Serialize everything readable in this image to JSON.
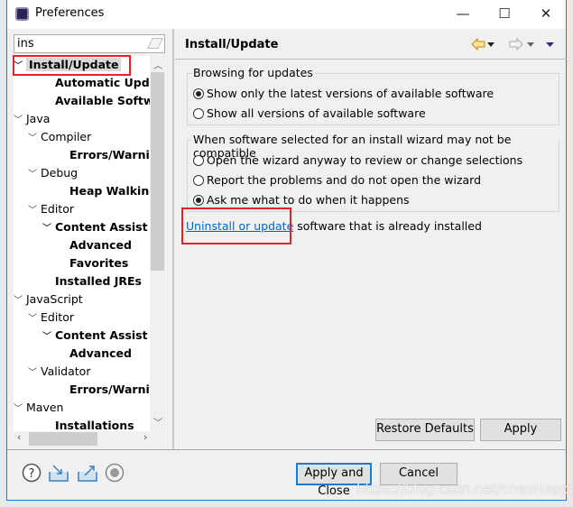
{
  "window": {
    "title": "Preferences",
    "minimize": "—",
    "maximize": "☐",
    "close": "✕"
  },
  "search": {
    "value": "ins"
  },
  "tree": [
    {
      "label": "Install/Update",
      "level": 0,
      "expanded": true,
      "bold": true,
      "selected": true
    },
    {
      "label": "Automatic Updates",
      "level": 2,
      "bold": true
    },
    {
      "label": "Available Software",
      "level": 2,
      "bold": true
    },
    {
      "label": "Java",
      "level": 0,
      "expanded": true
    },
    {
      "label": "Compiler",
      "level": 1,
      "expanded": true
    },
    {
      "label": "Errors/Warnings",
      "level": 3,
      "bold": true
    },
    {
      "label": "Debug",
      "level": 1,
      "expanded": true
    },
    {
      "label": "Heap Walking",
      "level": 3,
      "bold": true
    },
    {
      "label": "Editor",
      "level": 1,
      "expanded": true
    },
    {
      "label": "Content Assist",
      "level": 2,
      "expanded": true,
      "bold": true
    },
    {
      "label": "Advanced",
      "level": 3,
      "bold": true
    },
    {
      "label": "Favorites",
      "level": 3,
      "bold": true
    },
    {
      "label": "Installed JREs",
      "level": 2,
      "bold": true
    },
    {
      "label": "JavaScript",
      "level": 0,
      "expanded": true
    },
    {
      "label": "Editor",
      "level": 1,
      "expanded": true
    },
    {
      "label": "Content Assist",
      "level": 2,
      "expanded": true,
      "bold": true
    },
    {
      "label": "Advanced",
      "level": 3,
      "bold": true
    },
    {
      "label": "Validator",
      "level": 1,
      "expanded": true
    },
    {
      "label": "Errors/Warnings",
      "level": 3,
      "bold": true
    },
    {
      "label": "Maven",
      "level": 0,
      "expanded": true
    },
    {
      "label": "Installations",
      "level": 2,
      "bold": true
    }
  ],
  "page": {
    "title": "Install/Update",
    "browsing": {
      "label": "Browsing for updates",
      "options": [
        "Show only the latest versions of available software",
        "Show all versions of available software"
      ],
      "selected": 0
    },
    "compat": {
      "label": "When software selected for an install wizard may not be compatible",
      "options": [
        "Open the wizard anyway to review or change selections",
        "Report the problems and do not open the wizard",
        "Ask me what to do when it happens"
      ],
      "selected": 2
    },
    "link": "Uninstall or update",
    "link_suffix": " software that is already installed",
    "restore_defaults": "Restore Defaults",
    "apply": "Apply"
  },
  "footer": {
    "apply_close": "Apply and Close",
    "cancel": "Cancel"
  },
  "watermark": "https://blog.csdn.net/chaoHappy",
  "colors": {
    "highlight": "#e8202a",
    "link": "#0066cc",
    "focus": "#1a7ad4"
  }
}
